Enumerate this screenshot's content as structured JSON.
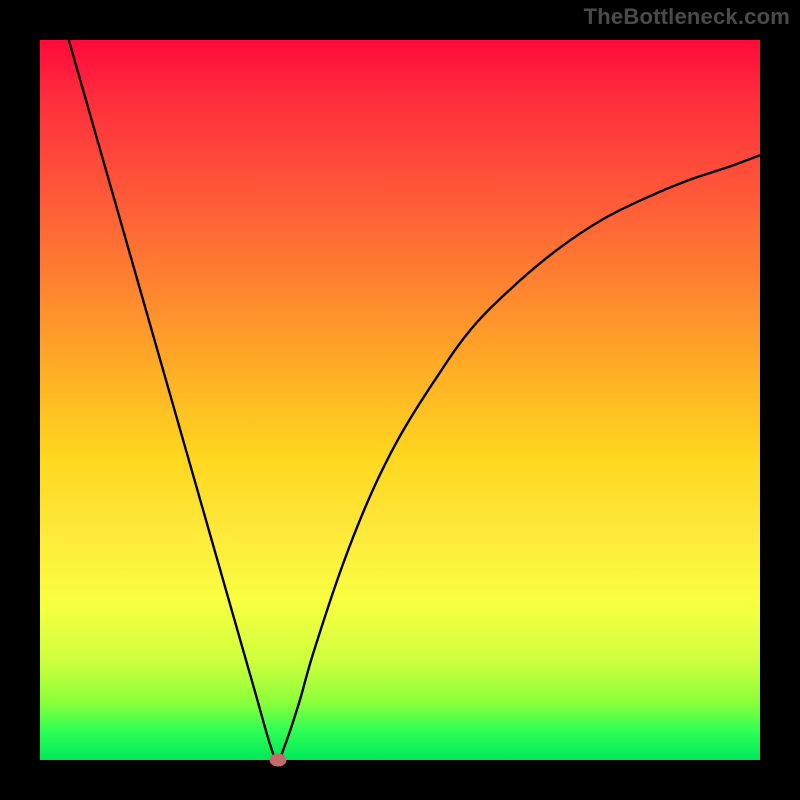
{
  "watermark": "TheBottleneck.com",
  "chart_data": {
    "type": "line",
    "title": "",
    "xlabel": "",
    "ylabel": "",
    "xlim": [
      0,
      100
    ],
    "ylim": [
      0,
      100
    ],
    "grid": false,
    "legend": false,
    "series": [
      {
        "name": "bottleneck-curve",
        "x": [
          4,
          8,
          12,
          16,
          20,
          24,
          28,
          30,
          32,
          33,
          34,
          36,
          38,
          42,
          46,
          50,
          55,
          60,
          66,
          72,
          78,
          84,
          90,
          96,
          100
        ],
        "values": [
          100,
          86,
          72,
          58,
          44,
          30,
          16,
          9,
          2,
          0,
          2,
          8,
          15,
          27,
          37,
          45,
          53,
          60,
          66,
          71,
          75,
          78,
          80.5,
          82.5,
          84
        ]
      }
    ],
    "minimum_marker": {
      "x": 33,
      "y": 0
    },
    "background_gradient": {
      "type": "vertical",
      "stops": [
        {
          "pos": 0,
          "color": "#ff0a3a"
        },
        {
          "pos": 50,
          "color": "#ffc224"
        },
        {
          "pos": 80,
          "color": "#f0ff40"
        },
        {
          "pos": 100,
          "color": "#00e85a"
        }
      ]
    }
  }
}
